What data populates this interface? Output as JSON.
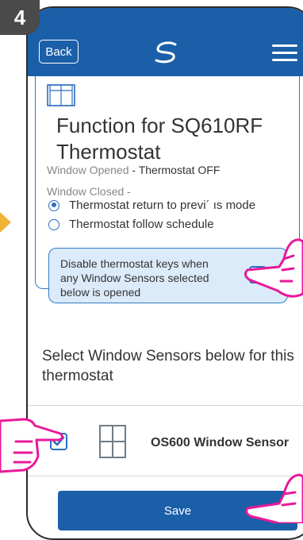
{
  "step": {
    "number": "4"
  },
  "header": {
    "back_label": "Back",
    "logo_icon": "salus-logo-icon",
    "menu_icon": "hamburger-menu-icon"
  },
  "function": {
    "window_icon": "window-icon",
    "title": "Function for SQ610RF Thermostat",
    "window_opened_label": "Window Opened",
    "window_opened_value": "Thermostat OFF",
    "window_closed_label": "Window Closed -",
    "options": [
      {
        "label": "Thermostat return to previ´ ıs mode",
        "selected": true
      },
      {
        "label": "Thermostat follow schedule",
        "selected": false
      }
    ],
    "disable_keys": {
      "text": "Disable thermostat keys when any Window Sensors selected below is opened",
      "checked": true
    }
  },
  "sensors": {
    "heading": "Select Window Sensors below for this thermostat",
    "items": [
      {
        "name": "OS600 Window Sensor",
        "checked": true,
        "icon": "window-sensor-icon"
      }
    ]
  },
  "footer": {
    "save_label": "Save"
  },
  "colors": {
    "primary": "#1b5fa8",
    "accent_border": "#2f78c8",
    "highlight_bg": "#dcebfa",
    "hand_pink": "#e8199a"
  }
}
